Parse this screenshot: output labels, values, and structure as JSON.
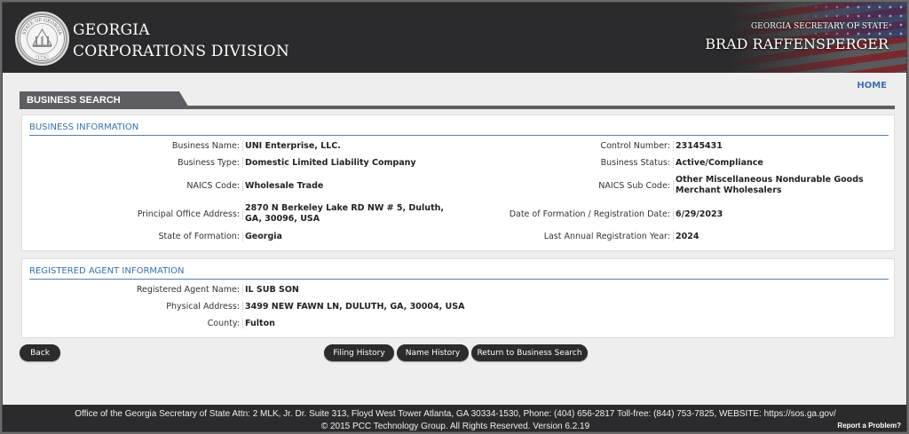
{
  "header": {
    "seal_icon": "georgia-state-seal-icon",
    "seal_text": "STATE OF GEORGIA",
    "seal_year": "1776",
    "title_line1": "GEORGIA",
    "title_line2": "CORPORATIONS DIVISION",
    "sos_label": "GEORGIA SECRETARY OF STATE",
    "sos_name": "BRAD RAFFENSPERGER"
  },
  "nav": {
    "home_label": "HOME"
  },
  "page_title": "BUSINESS SEARCH",
  "business_info": {
    "heading": "BUSINESS INFORMATION",
    "business_name_label": "Business Name:",
    "business_name": "UNI Enterprise, LLC.",
    "control_number_label": "Control Number:",
    "control_number": "23145431",
    "business_type_label": "Business Type:",
    "business_type": "Domestic Limited Liability Company",
    "business_status_label": "Business Status:",
    "business_status": "Active/Compliance",
    "naics_code_label": "NAICS Code:",
    "naics_code": "Wholesale Trade",
    "naics_sub_code_label": "NAICS Sub Code:",
    "naics_sub_code": "Other Miscellaneous Nondurable Goods Merchant Wholesalers",
    "principal_office_label": "Principal Office Address:",
    "principal_office": "2870 N Berkeley Lake RD NW # 5, Duluth, GA, 30096, USA",
    "date_of_formation_label": "Date of Formation / Registration Date:",
    "date_of_formation": "6/29/2023",
    "state_of_formation_label": "State of Formation:",
    "state_of_formation": "Georgia",
    "last_annual_reg_label": "Last Annual Registration Year:",
    "last_annual_reg": "2024"
  },
  "agent_info": {
    "heading": "REGISTERED AGENT INFORMATION",
    "agent_name_label": "Registered Agent Name:",
    "agent_name": "IL SUB SON",
    "physical_address_label": "Physical Address:",
    "physical_address": "3499 NEW FAWN LN, DULUTH, GA, 30004, USA",
    "county_label": "County:",
    "county": "Fulton"
  },
  "buttons": {
    "back": "Back",
    "filing_history": "Filing History",
    "name_history": "Name History",
    "return_to_search": "Return to Business Search"
  },
  "footer": {
    "line1": "Office of the Georgia Secretary of State Attn: 2 MLK, Jr. Dr. Suite 313, Floyd West Tower Atlanta, GA 30334-1530, Phone: (404) 656-2817 Toll-free: (844) 753-7825, WEBSITE: https://sos.ga.gov/",
    "line2": "© 2015 PCC Technology Group. All Rights Reserved. Version 6.2.19",
    "report_label": "Report a Problem?"
  },
  "colors": {
    "header_bg": "#2b2b2d",
    "accent_blue": "#3b6fb0",
    "titlebar": "#5c5e62",
    "button_bg": "#2c2c2e"
  }
}
